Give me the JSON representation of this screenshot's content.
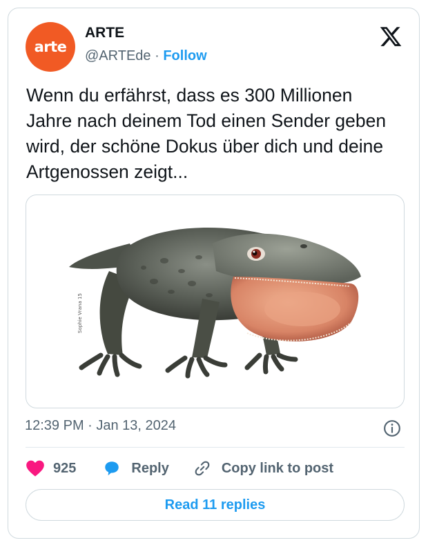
{
  "author": {
    "avatar_text": "arte",
    "name": "ARTE",
    "handle": "@ARTEde",
    "separator": "·",
    "follow_label": "Follow"
  },
  "tweet": {
    "text": "Wenn du erfährst, dass es 300 Millionen Jahre nach deinem Tod einen Sender geben wird, der schöne Dokus über dich und deine Artgenossen zeigt...",
    "media_icon": "amphibian-illustration",
    "media_signature": "Sophie Vrana 15"
  },
  "meta": {
    "timestamp": "12:39 PM · Jan 13, 2024"
  },
  "actions": {
    "likes": "925",
    "reply_label": "Reply",
    "copy_label": "Copy link to post"
  },
  "read_replies_label": "Read 11 replies",
  "colors": {
    "brand": "#f15a24",
    "accent": "#1d9bf0",
    "like": "#f91880"
  }
}
